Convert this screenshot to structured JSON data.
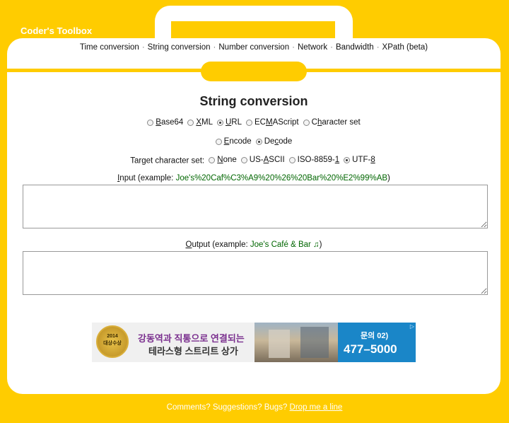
{
  "brand": "Coder's Toolbox",
  "nav": [
    "Time conversion",
    "String conversion",
    "Number conversion",
    "Network",
    "Bandwidth",
    "XPath (beta)"
  ],
  "title": "String conversion",
  "formats": [
    {
      "label": "Base64",
      "ak": "B",
      "selected": false
    },
    {
      "label": "XML",
      "ak": "X",
      "selected": false
    },
    {
      "label": "URL",
      "ak": "U",
      "selected": true
    },
    {
      "label": "ECMAScript",
      "ak": "M",
      "selected": false
    },
    {
      "label": "Character set",
      "ak": "h",
      "selected": false
    }
  ],
  "direction": [
    {
      "label": "Encode",
      "ak": "E",
      "selected": false
    },
    {
      "label": "Decode",
      "ak": "c",
      "selected": true
    }
  ],
  "charset_label": "Target character set:",
  "charsets": [
    {
      "label": "None",
      "ak": "N",
      "selected": false
    },
    {
      "label": "US-ASCII",
      "ak": "A",
      "selected": false
    },
    {
      "label": "ISO-8859-1",
      "ak": "1",
      "selected": false
    },
    {
      "label": "UTF-8",
      "ak": "8",
      "selected": true
    }
  ],
  "input": {
    "label": "Input",
    "example_prefix": " (example: ",
    "example": "Joe's%20Caf%C3%A9%20%26%20Bar%20%E2%99%AB",
    "suffix": ")",
    "value": ""
  },
  "output": {
    "label": "Output",
    "example_prefix": " (example: ",
    "example": "Joe's Café & Bar ♫",
    "suffix": ")",
    "value": ""
  },
  "ad": {
    "seal_year": "2014",
    "seal_text": "대상수상",
    "line1": "강동역과 직통으로 연결되는",
    "line2": "테라스형 스트리트 상가",
    "phone_prefix": "문의 02)",
    "phone": "477–5000"
  },
  "footer": {
    "text": "Comments? Suggestions? Bugs? ",
    "link": "Drop me a line"
  }
}
